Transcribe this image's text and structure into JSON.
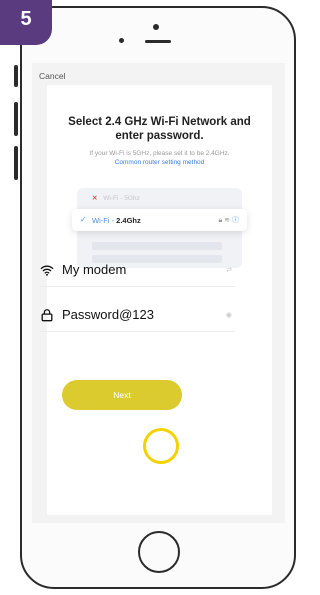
{
  "step": {
    "number": "5"
  },
  "header": {
    "cancel_label": "Cancel"
  },
  "main": {
    "title_line1": "Select 2.4 GHz Wi-Fi Network and",
    "title_line2": "enter password.",
    "hint": "If your Wi-Fi is 5GHz, please set it to be 2.4GHz.",
    "link": "Common router setting method"
  },
  "illustration": {
    "row_5ghz": "Wi-Fi - 5Ghz",
    "row_24_prefix": "Wi-Fi - ",
    "row_24_band": "2.4Ghz"
  },
  "network": {
    "ssid": "My modem"
  },
  "password": {
    "value": "Password@123"
  },
  "actions": {
    "next_label": "Next"
  },
  "colors": {
    "accent": "#dccb2e",
    "highlight": "#f2d300",
    "badge": "#5b3b80",
    "link": "#3a7de0"
  },
  "icons": {
    "wifi": "wifi-icon",
    "lock": "lock-icon",
    "swap": "swap-icon",
    "eye": "eye-icon"
  }
}
